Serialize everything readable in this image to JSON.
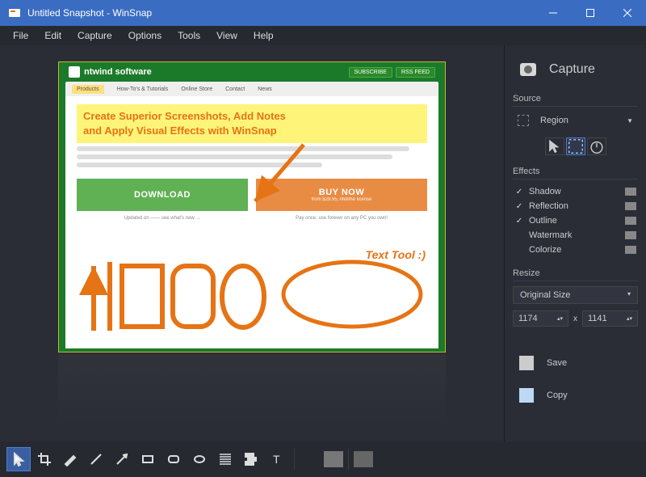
{
  "window": {
    "title": "Untitled Snapshot - WinSnap"
  },
  "menu": [
    "File",
    "Edit",
    "Capture",
    "Options",
    "Tools",
    "View",
    "Help"
  ],
  "snapshot": {
    "brand": "ntwind software",
    "subscribe": "SUBSCRIBE",
    "rss": "RSS FEED",
    "nav": [
      "Products",
      "How-To's & Tutorials",
      "Online Store",
      "Contact",
      "News"
    ],
    "headline_l1": "Create Superior Screenshots, Add Notes",
    "headline_l2": "and Apply Visual Effects with WinSnap",
    "download": "DOWNLOAD",
    "buy": "BUY NOW",
    "buy_sub": "from $29.95, lifetime license",
    "updated": "Updated on —— see what's new →",
    "payonce": "Pay once, use forever on any PC you own!",
    "text_tool": "Text Tool :)"
  },
  "sidebar": {
    "capture": "Capture",
    "source_title": "Source",
    "source_value": "Region",
    "effects_title": "Effects",
    "effects": [
      {
        "label": "Shadow",
        "checked": true
      },
      {
        "label": "Reflection",
        "checked": true
      },
      {
        "label": "Outline",
        "checked": true
      },
      {
        "label": "Watermark",
        "checked": false
      },
      {
        "label": "Colorize",
        "checked": false
      }
    ],
    "resize_title": "Resize",
    "resize_mode": "Original Size",
    "width": "1174",
    "height": "1141",
    "x": "x",
    "save": "Save",
    "copy": "Copy"
  },
  "toolbar": {
    "swatches": [
      "#555",
      "#777",
      "#666"
    ]
  }
}
